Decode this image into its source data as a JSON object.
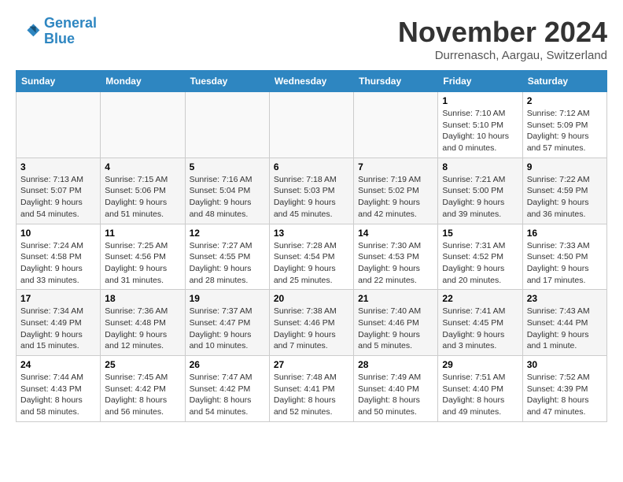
{
  "header": {
    "logo_line1": "General",
    "logo_line2": "Blue",
    "month_year": "November 2024",
    "location": "Durrenasch, Aargau, Switzerland"
  },
  "weekdays": [
    "Sunday",
    "Monday",
    "Tuesday",
    "Wednesday",
    "Thursday",
    "Friday",
    "Saturday"
  ],
  "weeks": [
    [
      {
        "day": "",
        "detail": ""
      },
      {
        "day": "",
        "detail": ""
      },
      {
        "day": "",
        "detail": ""
      },
      {
        "day": "",
        "detail": ""
      },
      {
        "day": "",
        "detail": ""
      },
      {
        "day": "1",
        "detail": "Sunrise: 7:10 AM\nSunset: 5:10 PM\nDaylight: 10 hours and 0 minutes."
      },
      {
        "day": "2",
        "detail": "Sunrise: 7:12 AM\nSunset: 5:09 PM\nDaylight: 9 hours and 57 minutes."
      }
    ],
    [
      {
        "day": "3",
        "detail": "Sunrise: 7:13 AM\nSunset: 5:07 PM\nDaylight: 9 hours and 54 minutes."
      },
      {
        "day": "4",
        "detail": "Sunrise: 7:15 AM\nSunset: 5:06 PM\nDaylight: 9 hours and 51 minutes."
      },
      {
        "day": "5",
        "detail": "Sunrise: 7:16 AM\nSunset: 5:04 PM\nDaylight: 9 hours and 48 minutes."
      },
      {
        "day": "6",
        "detail": "Sunrise: 7:18 AM\nSunset: 5:03 PM\nDaylight: 9 hours and 45 minutes."
      },
      {
        "day": "7",
        "detail": "Sunrise: 7:19 AM\nSunset: 5:02 PM\nDaylight: 9 hours and 42 minutes."
      },
      {
        "day": "8",
        "detail": "Sunrise: 7:21 AM\nSunset: 5:00 PM\nDaylight: 9 hours and 39 minutes."
      },
      {
        "day": "9",
        "detail": "Sunrise: 7:22 AM\nSunset: 4:59 PM\nDaylight: 9 hours and 36 minutes."
      }
    ],
    [
      {
        "day": "10",
        "detail": "Sunrise: 7:24 AM\nSunset: 4:58 PM\nDaylight: 9 hours and 33 minutes."
      },
      {
        "day": "11",
        "detail": "Sunrise: 7:25 AM\nSunset: 4:56 PM\nDaylight: 9 hours and 31 minutes."
      },
      {
        "day": "12",
        "detail": "Sunrise: 7:27 AM\nSunset: 4:55 PM\nDaylight: 9 hours and 28 minutes."
      },
      {
        "day": "13",
        "detail": "Sunrise: 7:28 AM\nSunset: 4:54 PM\nDaylight: 9 hours and 25 minutes."
      },
      {
        "day": "14",
        "detail": "Sunrise: 7:30 AM\nSunset: 4:53 PM\nDaylight: 9 hours and 22 minutes."
      },
      {
        "day": "15",
        "detail": "Sunrise: 7:31 AM\nSunset: 4:52 PM\nDaylight: 9 hours and 20 minutes."
      },
      {
        "day": "16",
        "detail": "Sunrise: 7:33 AM\nSunset: 4:50 PM\nDaylight: 9 hours and 17 minutes."
      }
    ],
    [
      {
        "day": "17",
        "detail": "Sunrise: 7:34 AM\nSunset: 4:49 PM\nDaylight: 9 hours and 15 minutes."
      },
      {
        "day": "18",
        "detail": "Sunrise: 7:36 AM\nSunset: 4:48 PM\nDaylight: 9 hours and 12 minutes."
      },
      {
        "day": "19",
        "detail": "Sunrise: 7:37 AM\nSunset: 4:47 PM\nDaylight: 9 hours and 10 minutes."
      },
      {
        "day": "20",
        "detail": "Sunrise: 7:38 AM\nSunset: 4:46 PM\nDaylight: 9 hours and 7 minutes."
      },
      {
        "day": "21",
        "detail": "Sunrise: 7:40 AM\nSunset: 4:46 PM\nDaylight: 9 hours and 5 minutes."
      },
      {
        "day": "22",
        "detail": "Sunrise: 7:41 AM\nSunset: 4:45 PM\nDaylight: 9 hours and 3 minutes."
      },
      {
        "day": "23",
        "detail": "Sunrise: 7:43 AM\nSunset: 4:44 PM\nDaylight: 9 hours and 1 minute."
      }
    ],
    [
      {
        "day": "24",
        "detail": "Sunrise: 7:44 AM\nSunset: 4:43 PM\nDaylight: 8 hours and 58 minutes."
      },
      {
        "day": "25",
        "detail": "Sunrise: 7:45 AM\nSunset: 4:42 PM\nDaylight: 8 hours and 56 minutes."
      },
      {
        "day": "26",
        "detail": "Sunrise: 7:47 AM\nSunset: 4:42 PM\nDaylight: 8 hours and 54 minutes."
      },
      {
        "day": "27",
        "detail": "Sunrise: 7:48 AM\nSunset: 4:41 PM\nDaylight: 8 hours and 52 minutes."
      },
      {
        "day": "28",
        "detail": "Sunrise: 7:49 AM\nSunset: 4:40 PM\nDaylight: 8 hours and 50 minutes."
      },
      {
        "day": "29",
        "detail": "Sunrise: 7:51 AM\nSunset: 4:40 PM\nDaylight: 8 hours and 49 minutes."
      },
      {
        "day": "30",
        "detail": "Sunrise: 7:52 AM\nSunset: 4:39 PM\nDaylight: 8 hours and 47 minutes."
      }
    ]
  ]
}
